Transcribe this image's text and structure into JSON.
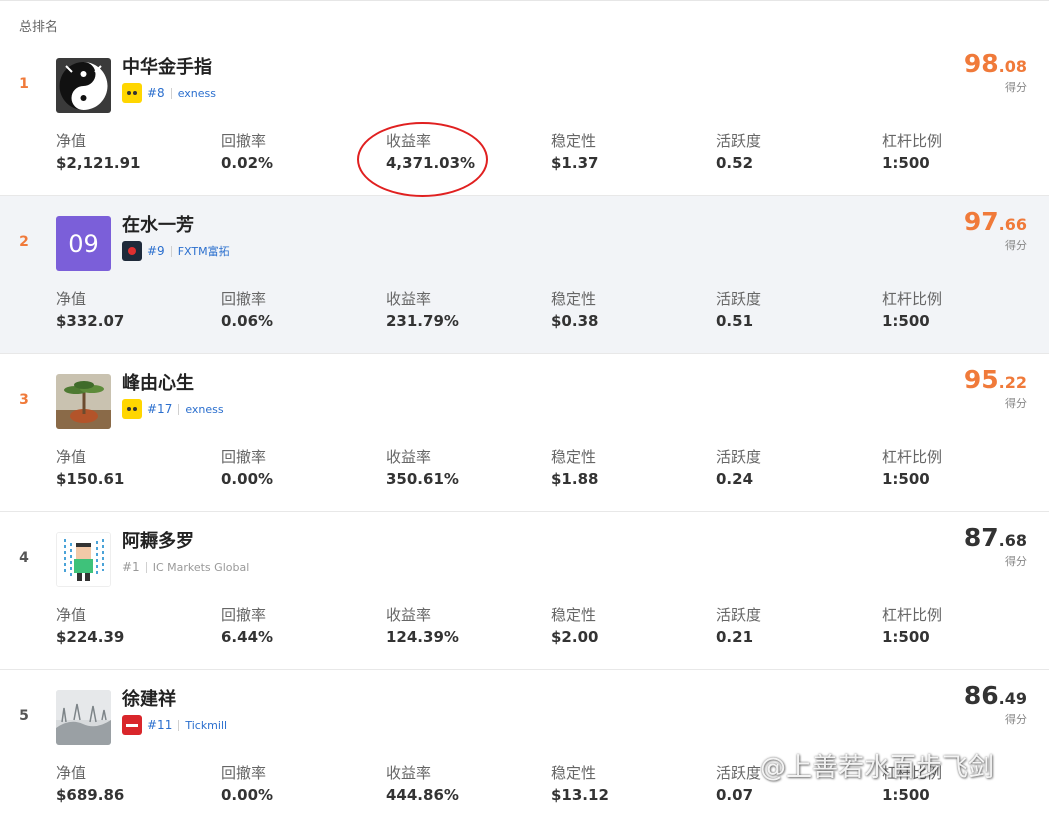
{
  "header": {
    "title": "总排名"
  },
  "metric_labels": [
    "净值",
    "回撤率",
    "收益率",
    "稳定性",
    "活跃度",
    "杠杆比例"
  ],
  "score_label": "得分",
  "entries": [
    {
      "rank": "1",
      "name": "中华金手指",
      "rank_tag": "#8",
      "broker": "exness",
      "score_int": "98",
      "score_dec": ".08",
      "metrics": [
        "$2,121.91",
        "0.02%",
        "4,371.03%",
        "$1.37",
        "0.52",
        "1:500"
      ]
    },
    {
      "rank": "2",
      "name": "在水一芳",
      "avatar_text": "09",
      "rank_tag": "#9",
      "broker": "FXTM富拓",
      "score_int": "97",
      "score_dec": ".66",
      "metrics": [
        "$332.07",
        "0.06%",
        "231.79%",
        "$0.38",
        "0.51",
        "1:500"
      ]
    },
    {
      "rank": "3",
      "name": "峰由心生",
      "rank_tag": "#17",
      "broker": "exness",
      "score_int": "95",
      "score_dec": ".22",
      "metrics": [
        "$150.61",
        "0.00%",
        "350.61%",
        "$1.88",
        "0.24",
        "1:500"
      ]
    },
    {
      "rank": "4",
      "name": "阿耨多罗",
      "rank_tag": "#1",
      "broker": "IC Markets Global",
      "score_int": "87",
      "score_dec": ".68",
      "metrics": [
        "$224.39",
        "6.44%",
        "124.39%",
        "$2.00",
        "0.21",
        "1:500"
      ]
    },
    {
      "rank": "5",
      "name": "徐建祥",
      "rank_tag": "#11",
      "broker": "Tickmill",
      "score_int": "86",
      "score_dec": ".49",
      "metrics": [
        "$689.86",
        "0.00%",
        "444.86%",
        "$13.12",
        "0.07",
        "1:500"
      ]
    }
  ],
  "colors": {
    "accent": "#f07a3a",
    "link": "#2b6fce",
    "avatar_purple": "#7b5fd9",
    "annotation": "#e02020"
  },
  "watermark": "@上善若水百步飞剑"
}
